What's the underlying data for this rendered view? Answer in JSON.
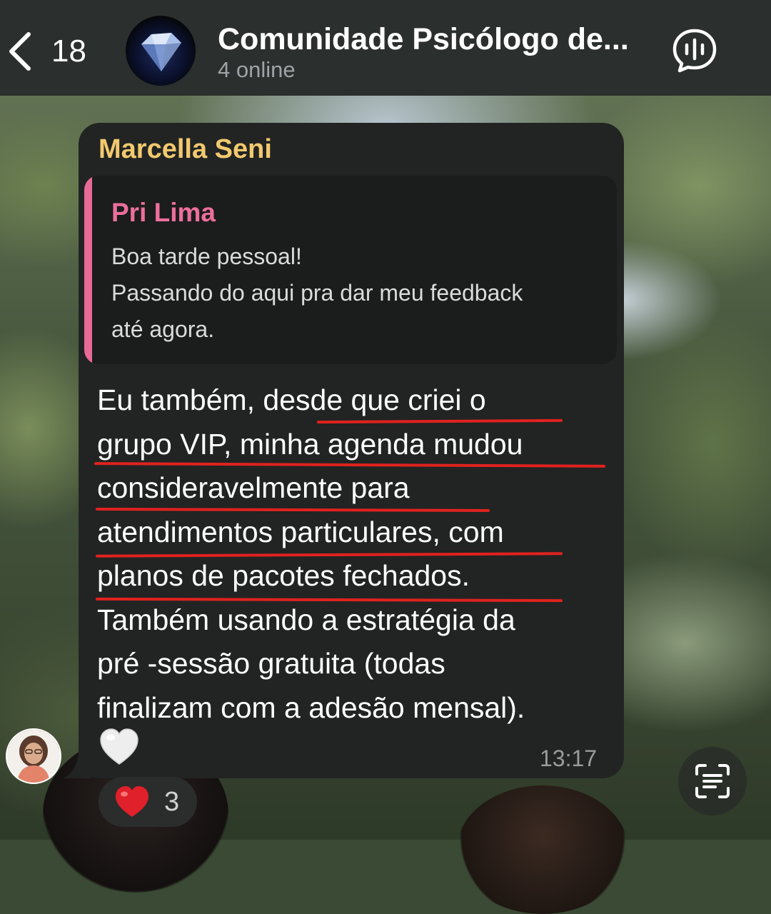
{
  "header": {
    "back_count": "18",
    "title": "Comunidade Psicólogo de...",
    "status": "4 online",
    "back_icon": "chevron-left-icon",
    "voice_icon": "voice-chat-icon"
  },
  "message": {
    "sender": "Marcella Seni",
    "reply": {
      "author": "Pri Lima",
      "lines": [
        "Boa tarde pessoal!",
        "Passando do aqui pra dar meu feedback",
        "até agora."
      ]
    },
    "body_lines": [
      "Eu também, desde que criei o",
      "grupo VIP,  minha agenda mudou",
      "consideravelmente para",
      "atendimentos particulares, com",
      "planos de pacotes fechados.",
      "Também usando a estratégia da",
      "pré -sessão gratuita (todas",
      "finalizam com a adesão mensal)."
    ],
    "inline_emoji": "white-heart-icon",
    "time": "13:17"
  },
  "reaction": {
    "emoji": "red-heart-icon",
    "count": "3"
  },
  "colors": {
    "sender_name": "#f2c96e",
    "reply_author": "#ec6f9c",
    "underline": "#e0221f",
    "header_bg": "#2b2f2d",
    "bubble_bg": "#222423"
  }
}
